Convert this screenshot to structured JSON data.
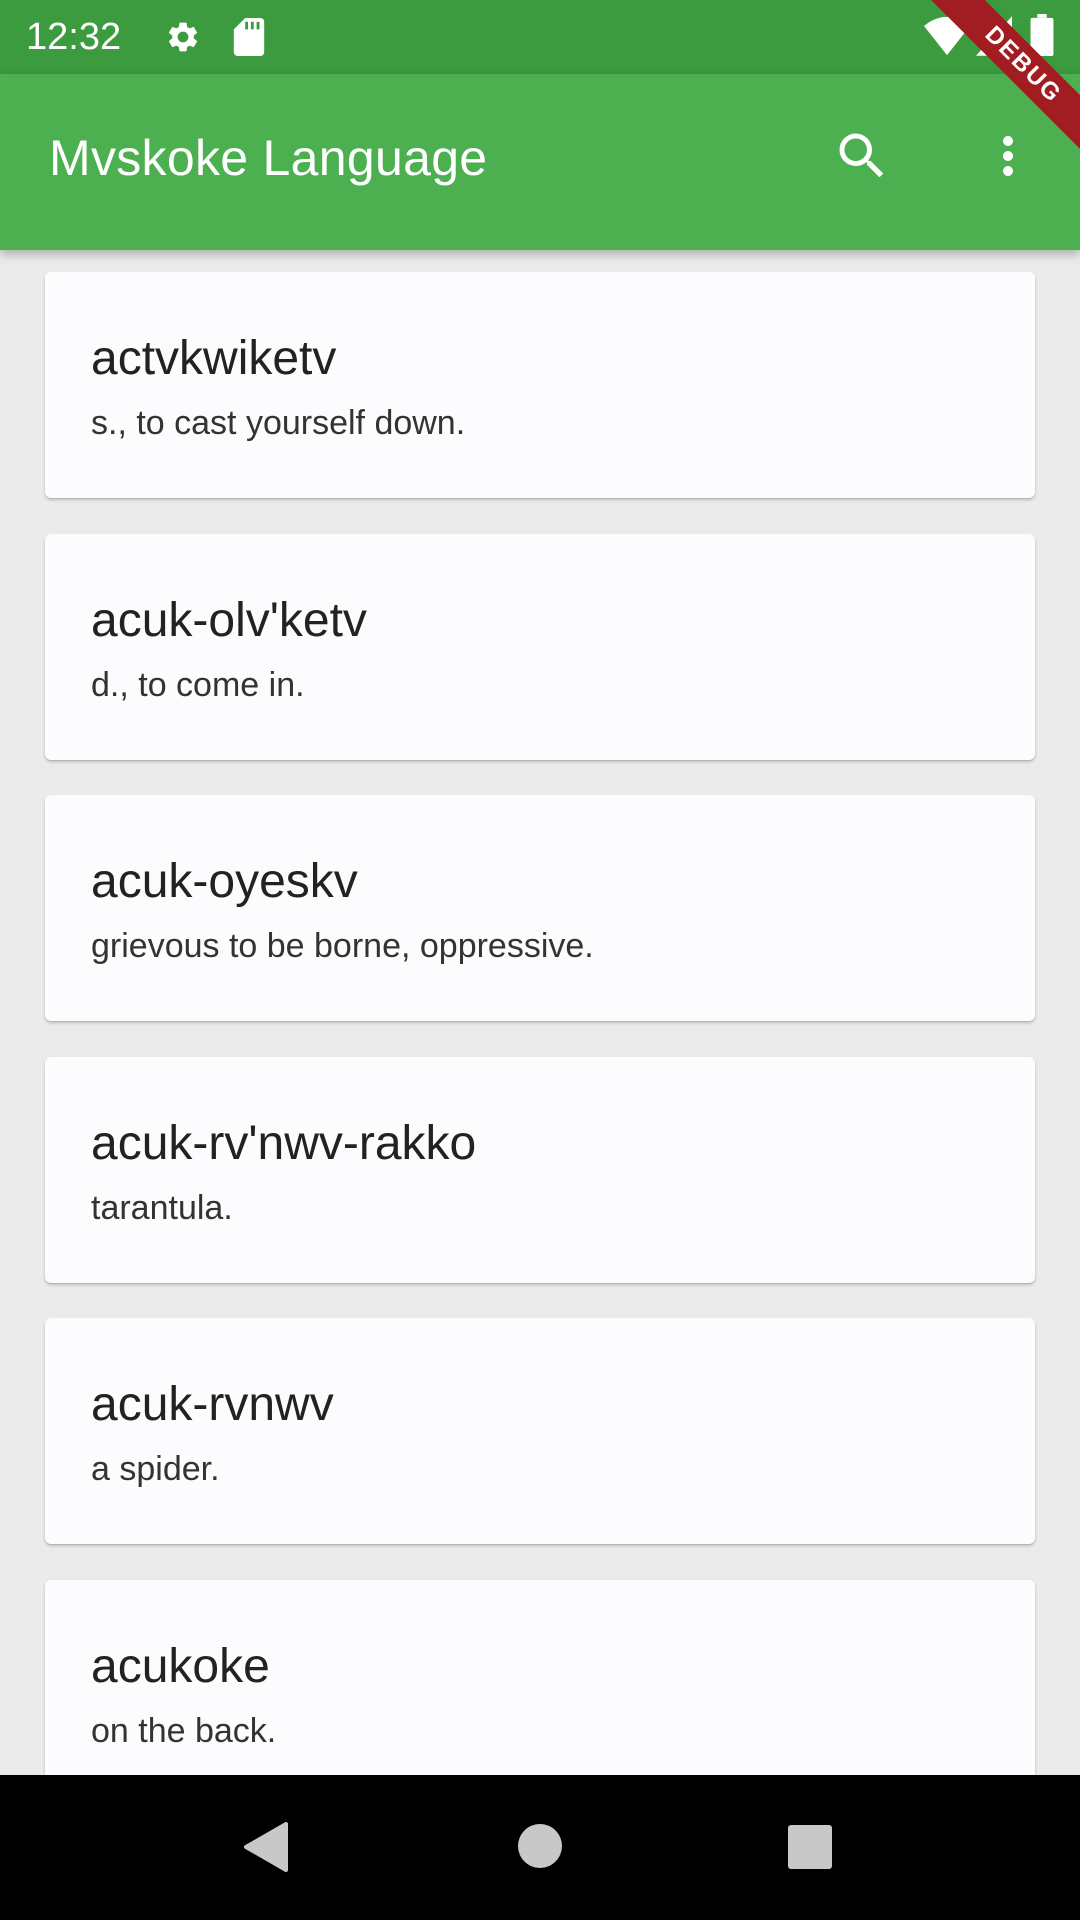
{
  "status_bar": {
    "time": "12:32",
    "icons": [
      "gear-icon",
      "sd-card-icon",
      "wifi-icon",
      "signal-icon",
      "battery-icon"
    ]
  },
  "app_bar": {
    "title": "Mvskoke Language",
    "actions": [
      "search-icon",
      "more-vert-icon"
    ]
  },
  "debug_banner": "DEBUG",
  "entries": [
    {
      "word": "actvkwiketv",
      "definition": "s., to cast yourself down."
    },
    {
      "word": "acuk-olv'ketv",
      "definition": "d., to come in."
    },
    {
      "word": "acuk-oyeskv",
      "definition": "grievous to be borne, oppressive."
    },
    {
      "word": "acuk-rv'nwv-rakko",
      "definition": "tarantula."
    },
    {
      "word": "acuk-rvnwv",
      "definition": "a spider."
    },
    {
      "word": "acukoke",
      "definition": "on the back."
    }
  ],
  "nav_bar": {
    "buttons": [
      "back-icon",
      "home-icon",
      "recents-icon"
    ]
  },
  "colors": {
    "status_bar": "#3c9a3f",
    "app_bar": "#4caf50",
    "background": "#ebebeb",
    "card": "#fcfcfe",
    "debug_ribbon": "#a11d22"
  }
}
